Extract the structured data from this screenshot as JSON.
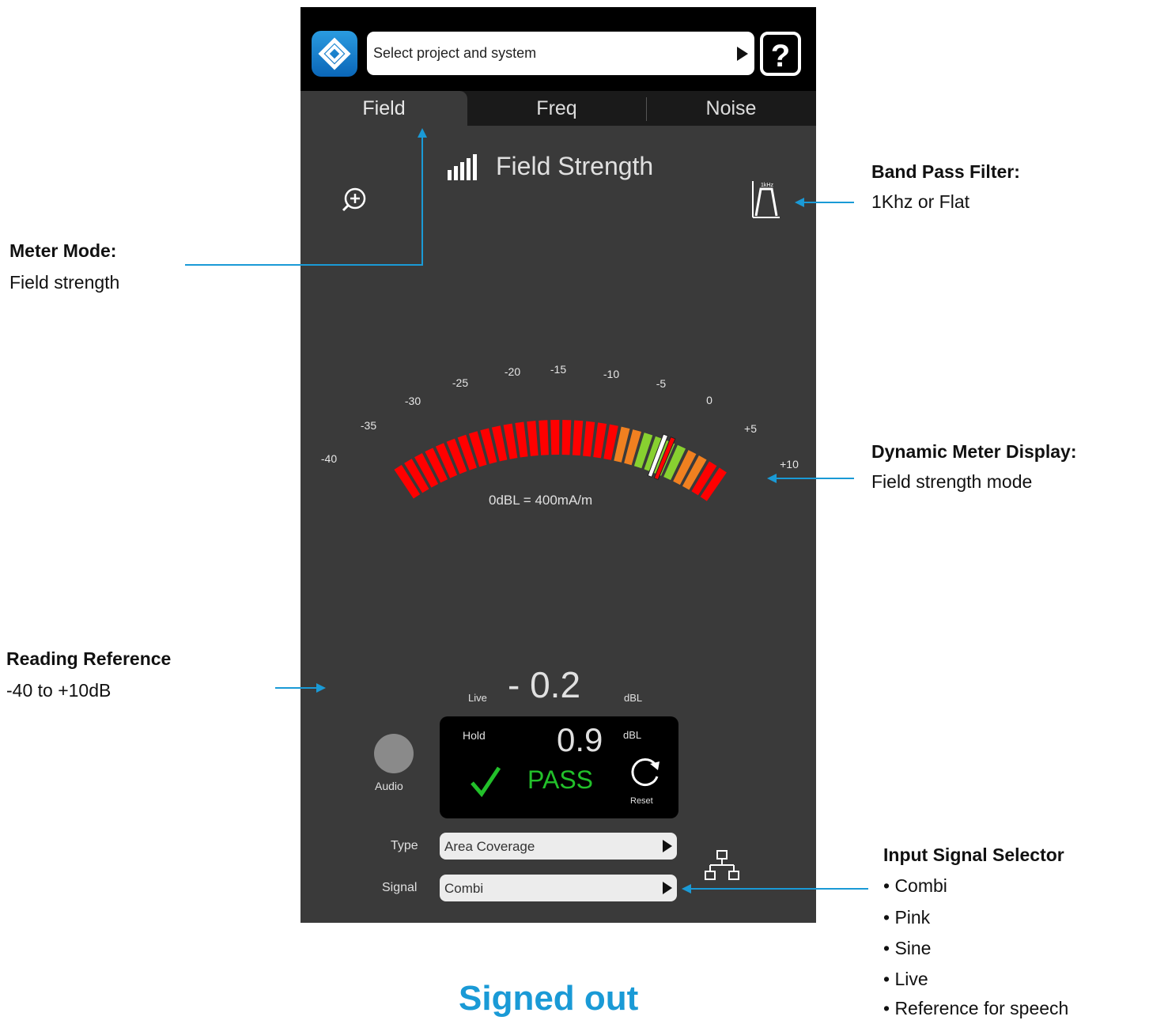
{
  "header": {
    "project_select_label": "Select project and system",
    "help_label": "?"
  },
  "tabs": [
    {
      "label": "Field",
      "selected": true
    },
    {
      "label": "Freq",
      "selected": false
    },
    {
      "label": "Noise",
      "selected": false
    }
  ],
  "meter": {
    "title": "Field Strength",
    "scale_ticks": [
      "-40",
      "-35",
      "-30",
      "-25",
      "-20",
      "-15",
      "-10",
      "-5",
      "0",
      "+5",
      "+10"
    ],
    "scale_min_db": -40,
    "scale_max_db": 10,
    "reference_text": "0dBL = 400mA/m",
    "live_needle_db": -0.2,
    "hold_needle_db": 0.9
  },
  "readings": {
    "live_label": "Live",
    "live_value": "- 0.2",
    "live_unit": "dBL",
    "hold_label": "Hold",
    "hold_value": "0.9",
    "hold_unit": "dBL",
    "status": "PASS",
    "reset_label": "Reset",
    "audio_label": "Audio"
  },
  "selectors": {
    "type_label": "Type",
    "type_value": "Area Coverage",
    "signal_label": "Signal",
    "signal_value": "Combi"
  },
  "colors": {
    "accent_blue": "#1a9ad6",
    "pass_green": "#22c02a",
    "segment_red": "#ff0000",
    "segment_orange": "#f08020",
    "segment_green": "#88d030"
  },
  "callouts": {
    "meter_mode_title": "Meter Mode:",
    "meter_mode_body": "Field strength",
    "band_pass_title": "Band Pass Filter:",
    "band_pass_body": "1Khz or Flat",
    "dynamic_title": "Dynamic Meter Display:",
    "dynamic_body": "Field strength mode",
    "reading_ref_title": "Reading Reference",
    "reading_ref_body": "-40 to +10dB",
    "input_signal_title": "Input Signal Selector",
    "input_signal_items": [
      "• Combi",
      "• Pink",
      "• Sine",
      "• Live",
      "• Reference for speech"
    ]
  },
  "footer": {
    "status": "Signed out"
  }
}
